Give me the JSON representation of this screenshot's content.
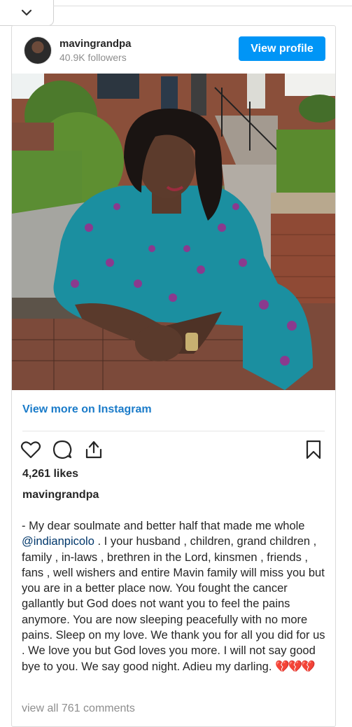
{
  "post": {
    "username": "mavingrandpa",
    "followers": "40.9K followers",
    "view_profile_label": "View profile",
    "view_more_label": "View more on Instagram",
    "likes": "4,261 likes",
    "author": "mavingrandpa",
    "caption_part1": "- My dear soulmate and better half that made me whole ",
    "caption_mention": "@indianpicolo",
    "caption_part2": " . I your husband , children, grand children , family , in-laws , brethren in the Lord, kinsmen , friends , fans , well wishers and entire Mavin family will miss you but you are in a better place now. You fought the cancer gallantly but God does not want you to feel the pains anymore. You are now sleeping peacefully with no more pains. Sleep on my love. We thank you for all you did for us . We love you but God loves you more. I will not say good bye to you. We say good night. Adieu my darling. ",
    "caption_emoji": "💔💔💔",
    "view_comments": "view all 761 comments"
  },
  "icons": {
    "collapse": "chevron-down-icon",
    "like": "heart-icon",
    "comment": "comment-icon",
    "share": "share-icon",
    "save": "bookmark-icon"
  },
  "colors": {
    "accent": "#0095f6",
    "link": "#1a7bc9",
    "text": "#262626",
    "muted": "#8e8e8e"
  }
}
